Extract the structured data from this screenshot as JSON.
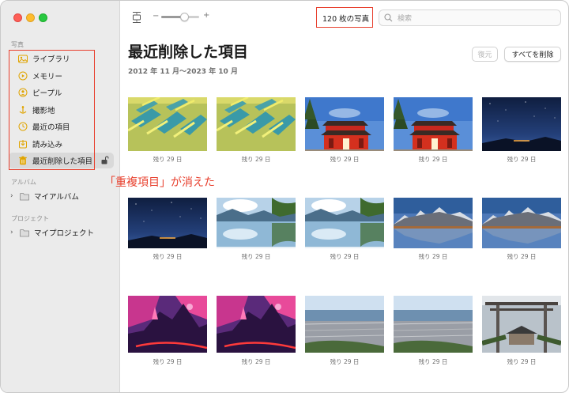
{
  "window": {
    "colors": {
      "close": "#fe5f57",
      "minimize": "#febc2e",
      "zoom": "#28c840",
      "annotation_red": "#e8402e"
    }
  },
  "sidebar": {
    "section_photos": "写真",
    "items": [
      {
        "label": "ライブラリ",
        "icon": "library-icon"
      },
      {
        "label": "メモリー",
        "icon": "memories-icon"
      },
      {
        "label": "ピープル",
        "icon": "people-icon"
      },
      {
        "label": "撮影地",
        "icon": "places-icon"
      },
      {
        "label": "最近の項目",
        "icon": "recents-icon"
      },
      {
        "label": "読み込み",
        "icon": "imports-icon"
      },
      {
        "label": "最近削除した項目",
        "icon": "trash-icon",
        "selected": true,
        "locked": false
      }
    ],
    "section_albums": "アルバム",
    "albums": [
      {
        "label": "マイアルバム"
      }
    ],
    "section_projects": "プロジェクト",
    "projects": [
      {
        "label": "マイプロジェクト"
      }
    ]
  },
  "toolbar": {
    "photo_count": "120 枚の写真",
    "search_placeholder": "検索",
    "zoom_level": 0.55
  },
  "main": {
    "title": "最近削除した項目",
    "date_range": "2012 年 11 月〜2023 年 10 月",
    "restore_label": "復元",
    "delete_all_label": "すべてを削除",
    "photos": [
      {
        "caption": "残り 29 日",
        "scene": "farmland-maze"
      },
      {
        "caption": "残り 29 日",
        "scene": "farmland-maze"
      },
      {
        "caption": "残り 29 日",
        "scene": "red-shrine"
      },
      {
        "caption": "残り 29 日",
        "scene": "red-shrine"
      },
      {
        "caption": "残り 29 日",
        "scene": "night-sky"
      },
      {
        "caption": "残り 29 日",
        "scene": "night-sky"
      },
      {
        "caption": "残り 29 日",
        "scene": "lake-reflection"
      },
      {
        "caption": "残り 29 日",
        "scene": "lake-reflection"
      },
      {
        "caption": "残り 29 日",
        "scene": "mountain-lake"
      },
      {
        "caption": "残り 29 日",
        "scene": "mountain-lake"
      },
      {
        "caption": "残り 29 日",
        "scene": "purple-fantasy"
      },
      {
        "caption": "残り 29 日",
        "scene": "purple-fantasy"
      },
      {
        "caption": "残り 29 日",
        "scene": "city-aerial"
      },
      {
        "caption": "残り 29 日",
        "scene": "city-aerial"
      },
      {
        "caption": "残り 29 日",
        "scene": "torii-shrine"
      }
    ]
  },
  "annotation": {
    "text": "「重複項目」が消えた"
  }
}
